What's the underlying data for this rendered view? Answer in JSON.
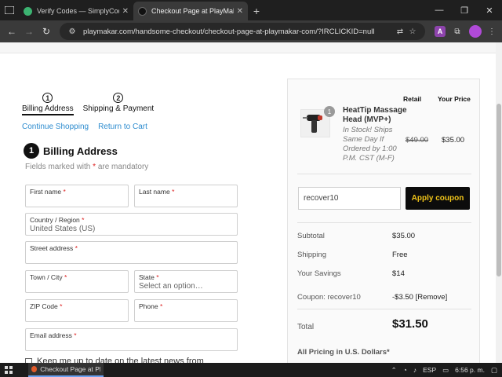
{
  "browser": {
    "tabs": [
      {
        "title": "Verify Codes — SimplyCodes",
        "active": false,
        "favicon_color": "#3cb371"
      },
      {
        "title": "Checkout Page at PlayMakar.co",
        "active": true,
        "favicon_color": "#111111"
      }
    ],
    "url": "playmakar.com/handsome-checkout/checkout-page-at-playmakar-com/?IRCLICKID=null",
    "extension_letter": "A"
  },
  "checkout": {
    "steps": [
      {
        "number": "1",
        "label": "Billing Address"
      },
      {
        "number": "2",
        "label": "Shipping & Payment"
      }
    ],
    "links": {
      "continue": "Continue Shopping",
      "return": "Return to Cart"
    },
    "section": {
      "badge": "1",
      "title": "Billing Address"
    },
    "mandatory_prefix": "Fields marked with",
    "mandatory_star": "*",
    "mandatory_suffix": "are mandatory",
    "required_mark": "*",
    "fields": {
      "first_name": {
        "label": "First name",
        "value": ""
      },
      "last_name": {
        "label": "Last name",
        "value": ""
      },
      "country": {
        "label": "Country / Region",
        "value": "United States (US)"
      },
      "street": {
        "label": "Street address",
        "value": ""
      },
      "city": {
        "label": "Town / City",
        "value": ""
      },
      "state": {
        "label": "State",
        "value": "Select an option…"
      },
      "zip": {
        "label": "ZIP Code",
        "value": ""
      },
      "phone": {
        "label": "Phone",
        "value": ""
      },
      "email": {
        "label": "Email address",
        "value": ""
      }
    },
    "newsletter_label": "Keep me up to date on the latest news from"
  },
  "summary": {
    "col_retail": "Retail",
    "col_your_price": "Your Price",
    "product": {
      "name": "HeatTip Massage Head (MVP+)",
      "stock": "In Stock! Ships Same Day If Ordered by 1:00 P.M. CST (M-F)",
      "qty": "1",
      "retail": "$49.00",
      "your_price": "$35.00"
    },
    "coupon": {
      "value": "recover10",
      "button": "Apply coupon"
    },
    "rows": {
      "subtotal_label": "Subtotal",
      "subtotal_value": "$35.00",
      "shipping_label": "Shipping",
      "shipping_value": "Free",
      "savings_label": "Your Savings",
      "savings_value": "$14",
      "coupon_label": "Coupon: recover10",
      "coupon_value": "-$3.50",
      "coupon_remove": "[Remove]"
    },
    "total_label": "Total",
    "total_value": "$31.50",
    "pricing_note": "All Pricing in U.S. Dollars*",
    "accent_color": "#f0c419",
    "link_color": "#2d8ccf"
  },
  "taskbar": {
    "app_title": "Checkout Page at Pl...",
    "language": "ESP",
    "time": "6:56 p. m."
  }
}
